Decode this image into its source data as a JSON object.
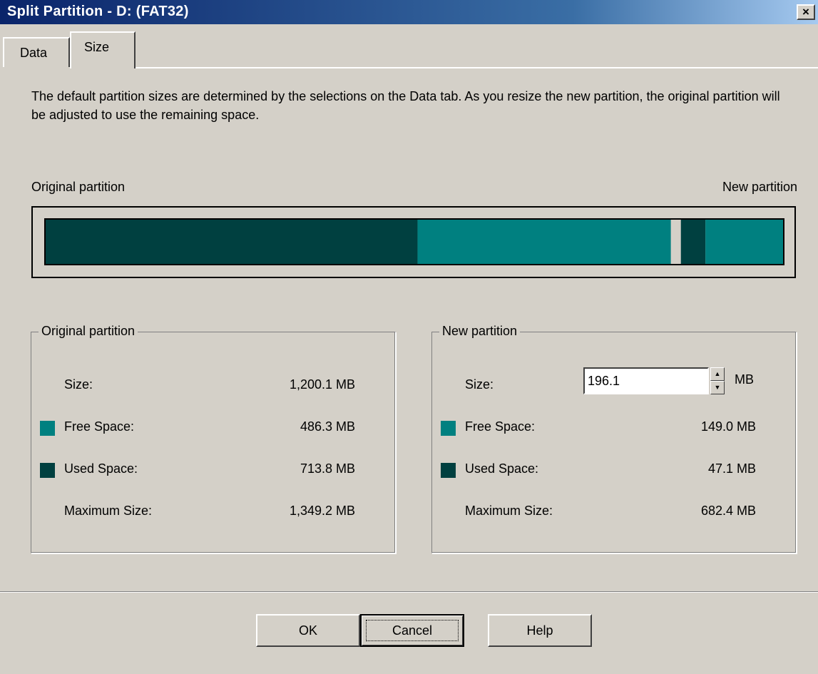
{
  "window": {
    "title": "Split Partition - D:  (FAT32)",
    "close_glyph": "×"
  },
  "tabs": [
    {
      "label": "Data",
      "selected": false
    },
    {
      "label": "Size",
      "selected": true
    }
  ],
  "description": "The default partition sizes are determined by the selections on the Data tab. As you resize the new partition, the original partition will be adjusted to use the remaining space.",
  "bar_labels": {
    "left": "Original partition",
    "right": "New partition"
  },
  "colors": {
    "free": "#008080",
    "used": "#004040",
    "bar_background": "#d4d0c8"
  },
  "partition_bar": {
    "original": {
      "size_mb": 1200.1,
      "used_mb": 713.8,
      "free_mb": 486.3
    },
    "new": {
      "size_mb": 196.1,
      "used_mb": 47.1,
      "free_mb": 149.0
    }
  },
  "original_partition": {
    "title": "Original partition",
    "rows": [
      {
        "label": "Size:",
        "value": "1,200.1  MB"
      },
      {
        "label": "Free Space:",
        "value": "486.3  MB"
      },
      {
        "label": "Used Space:",
        "value": "713.8  MB"
      },
      {
        "label": "Maximum Size:",
        "value": "1,349.2  MB"
      }
    ]
  },
  "new_partition": {
    "title": "New partition",
    "size_label": "Size:",
    "size_value": "196.1",
    "size_unit": "MB",
    "rows": [
      {
        "label": "Free Space:",
        "value": "149.0  MB"
      },
      {
        "label": "Used Space:",
        "value": "47.1  MB"
      },
      {
        "label": "Maximum Size:",
        "value": "682.4  MB"
      }
    ]
  },
  "buttons": {
    "ok": "OK",
    "cancel": "Cancel",
    "help": "Help"
  },
  "icons": {
    "spin_up": "▲",
    "spin_down": "▼"
  }
}
